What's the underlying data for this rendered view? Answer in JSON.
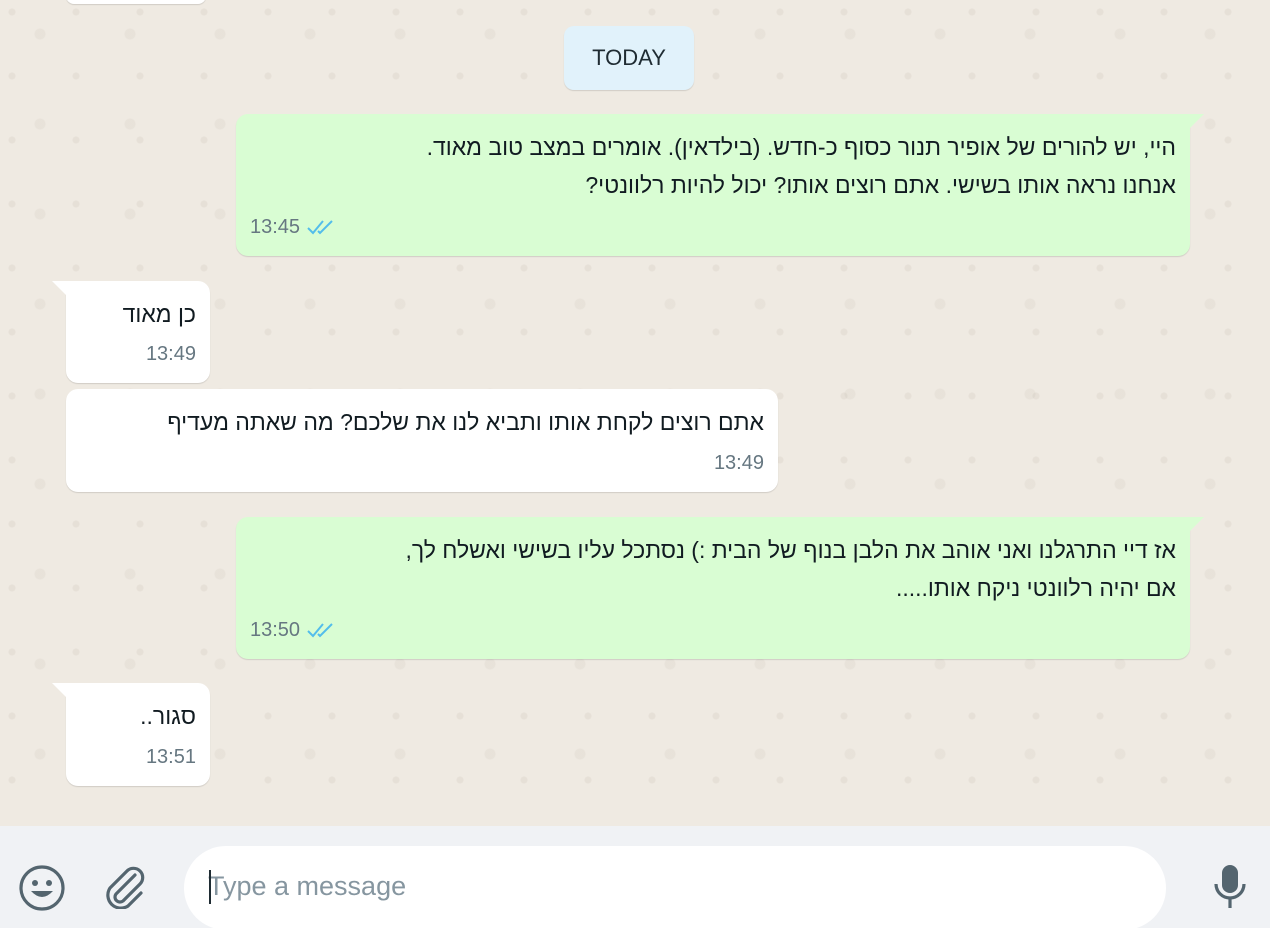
{
  "date_divider": "TODAY",
  "colors": {
    "outgoing_bubble": "#d9fdd3",
    "incoming_bubble": "#ffffff",
    "read_ticks": "#53bdeb",
    "date_pill": "#e1f2fb"
  },
  "messages": [
    {
      "direction": "outgoing",
      "text": "היי, יש להורים של אופיר תנור כסוף כ-חדש. (בילדאין). אומרים במצב טוב מאוד.\nאנחנו נראה אותו בשישי. אתם רוצים אותו? יכול להיות רלוונטי?",
      "time": "13:45",
      "status_icon": "double-check-read-icon"
    },
    {
      "direction": "incoming",
      "text": "כן מאוד",
      "time": "13:49"
    },
    {
      "direction": "incoming",
      "text": "אתם רוצים לקחת אותו ותביא לנו את שלכם? מה שאתה מעדיף",
      "time": "13:49"
    },
    {
      "direction": "outgoing",
      "text": "אז דיי התרגלנו ואני אוהב את הלבן בנוף של הבית :) נסתכל עליו בשישי ואשלח לך,\nאם יהיה רלוונטי ניקח אותו.....",
      "time": "13:50",
      "status_icon": "double-check-read-icon"
    },
    {
      "direction": "incoming",
      "text": "סגור..",
      "time": "13:51"
    }
  ],
  "composer": {
    "placeholder": "Type a message",
    "emoji_icon": "smiley-icon",
    "attach_icon": "paperclip-icon",
    "mic_icon": "microphone-icon"
  }
}
